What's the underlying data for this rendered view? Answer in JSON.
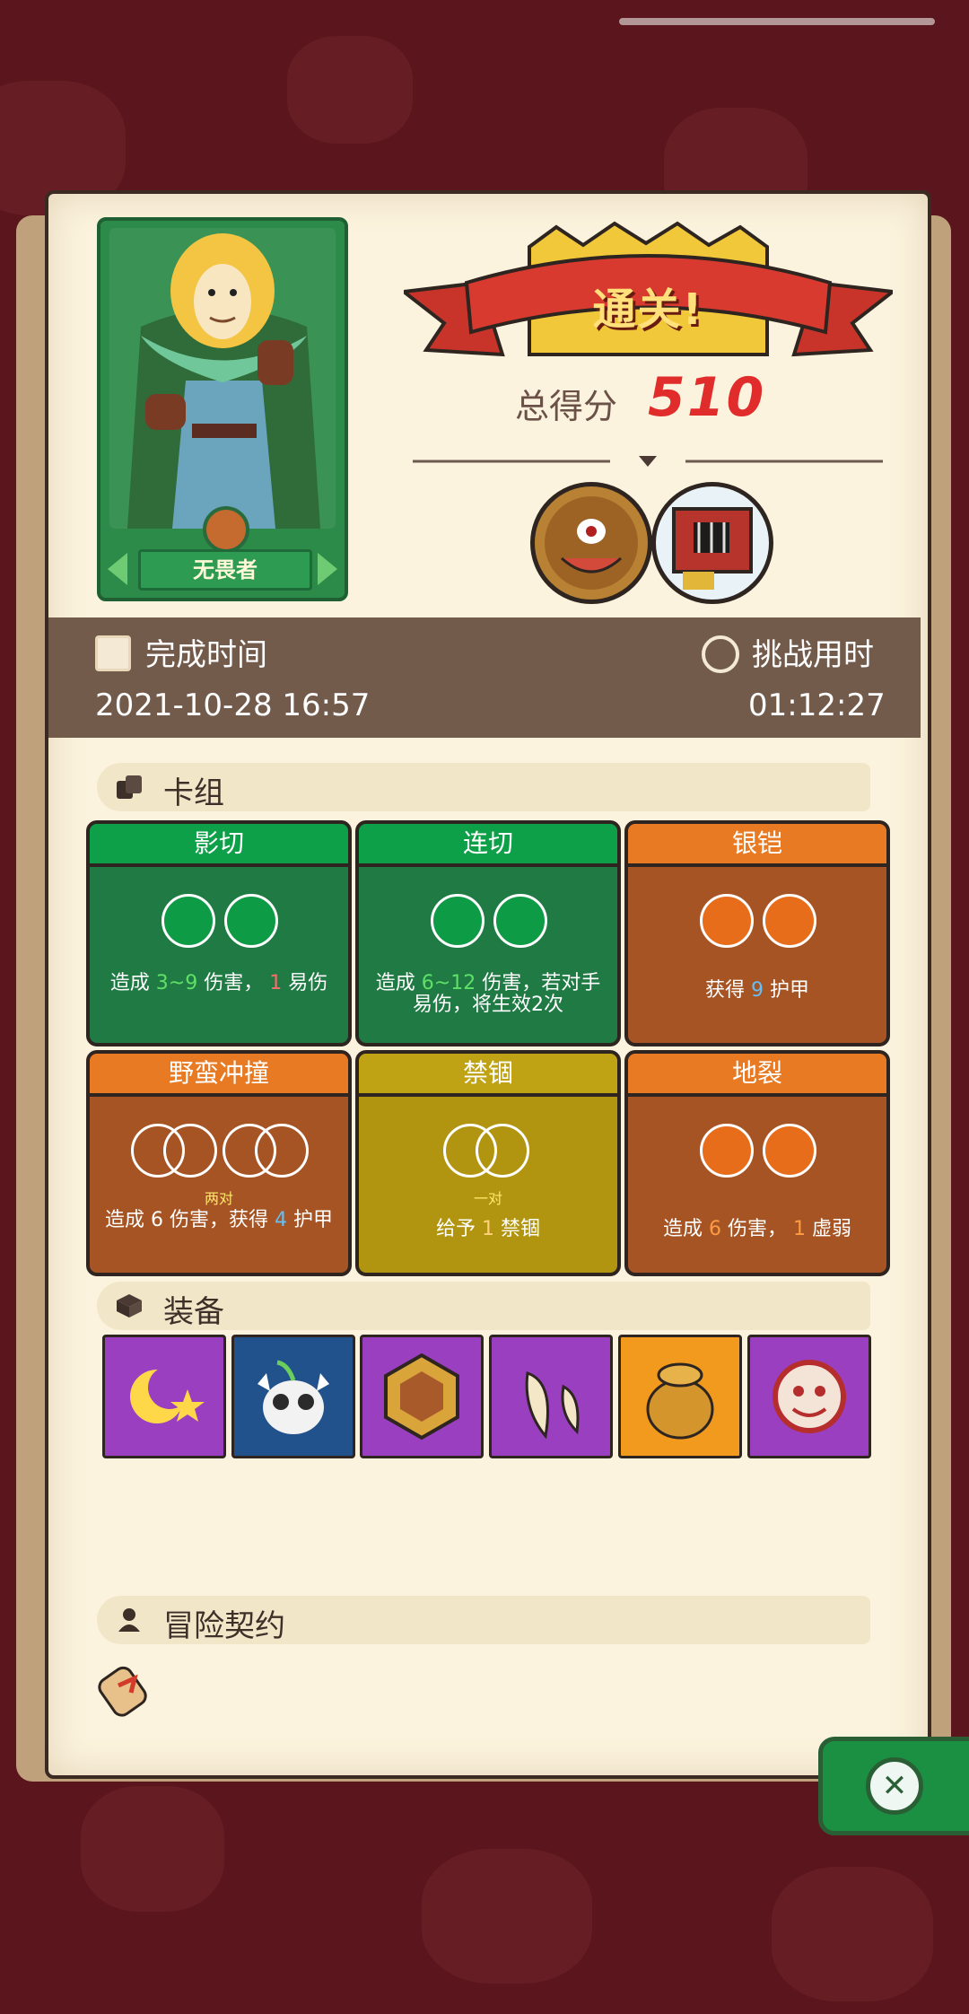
{
  "hero": {
    "name": "无畏者"
  },
  "result": {
    "banner": "通关!",
    "score_label": "总得分",
    "score_value": "510"
  },
  "times": {
    "finish_label": "完成时间",
    "finish_value": "2021-10-28 16:57",
    "challenge_label": "挑战用时",
    "challenge_value": "01:12:27"
  },
  "deck": {
    "title": "卡组",
    "cards": [
      {
        "name": "影切",
        "desc_prefix": "造成",
        "desc_val1": "3~9",
        "desc_mid": "伤害，",
        "desc_val2": "1",
        "desc_suffix": "易伤"
      },
      {
        "name": "连切",
        "desc_prefix": "造成",
        "desc_val1": "6~12",
        "desc_mid": "伤害，若对手",
        "desc_suffix": "易伤，将生效2次"
      },
      {
        "name": "银铠",
        "desc_prefix": "获得",
        "desc_val1": "9",
        "desc_suffix": "护甲"
      },
      {
        "name": "野蛮冲撞",
        "sub": "两对",
        "desc_prefix": "造成",
        "desc_val1": "6",
        "desc_mid": "伤害，获得",
        "desc_val2": "4",
        "desc_suffix": "护甲"
      },
      {
        "name": "禁锢",
        "sub": "一对",
        "desc_prefix": "给予",
        "desc_val1": "1",
        "desc_suffix": "禁锢"
      },
      {
        "name": "地裂",
        "desc_prefix": "造成",
        "desc_val1": "6",
        "desc_mid": "伤害，",
        "desc_val2": "1",
        "desc_suffix": "虚弱"
      }
    ]
  },
  "equipment": {
    "title": "装备",
    "items": [
      "moon-icon",
      "skull-sprout-icon",
      "hex-amulet-icon",
      "fangs-icon",
      "treasure-bag-icon",
      "sun-mask-icon"
    ]
  },
  "contract": {
    "title": "冒险契约",
    "item": "scroll-icon"
  },
  "colors": {
    "green_card": "#1f7a43",
    "brown_card": "#a65424",
    "olive_card": "#b1940f",
    "accent_red": "#e12c2c"
  }
}
